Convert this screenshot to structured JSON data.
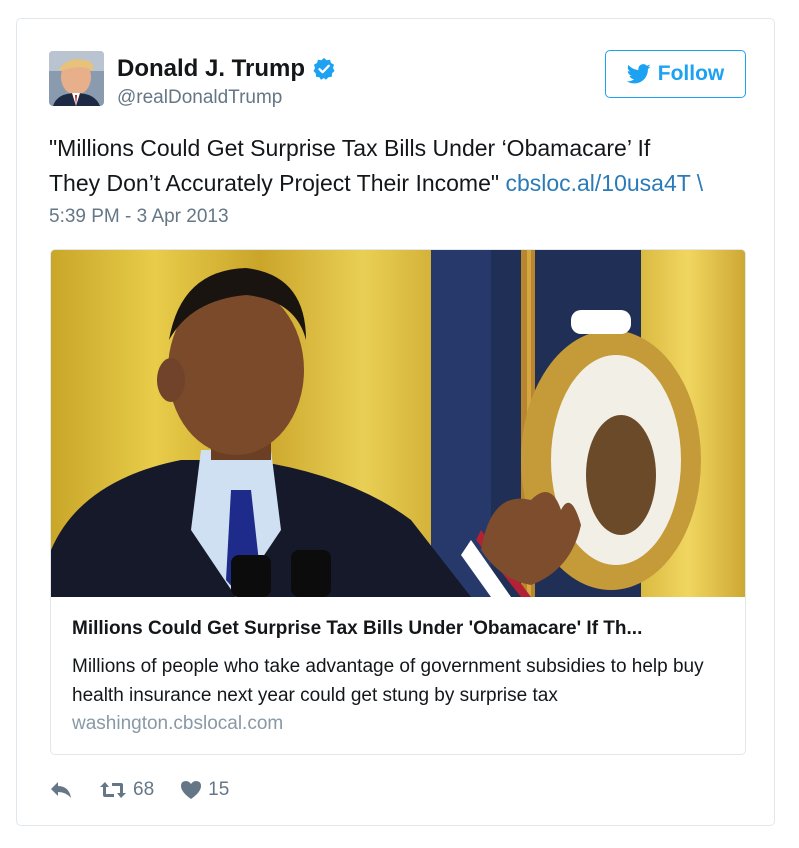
{
  "tweet": {
    "name": "Donald J. Trump",
    "handle": "@realDonaldTrump",
    "follow_label": "Follow",
    "text_line1": "\"Millions Could Get Surprise Tax Bills Under ‘Obamacare’ If",
    "text_line2": "They Don’t Accurately Project Their Income\" ",
    "link_text": "cbsloc.al/10usa4T \\",
    "timestamp": "5:39 PM - 3 Apr 2013"
  },
  "card": {
    "title": "Millions Could Get Surprise Tax Bills Under 'Obamacare' If Th...",
    "description": "Millions of people who take advantage of government subsidies to help buy health insurance next year could get stung by surprise tax",
    "domain": "washington.cbslocal.com"
  },
  "actions": {
    "retweets": "68",
    "likes": "15"
  },
  "icons": {
    "verified": "verified-badge-icon",
    "follow": "twitter-bird-icon",
    "reply": "reply-icon",
    "retweet": "retweet-icon",
    "like": "heart-icon"
  },
  "colors": {
    "accent": "#1da1f2",
    "link": "#2b7bb9",
    "muted": "#657786"
  }
}
